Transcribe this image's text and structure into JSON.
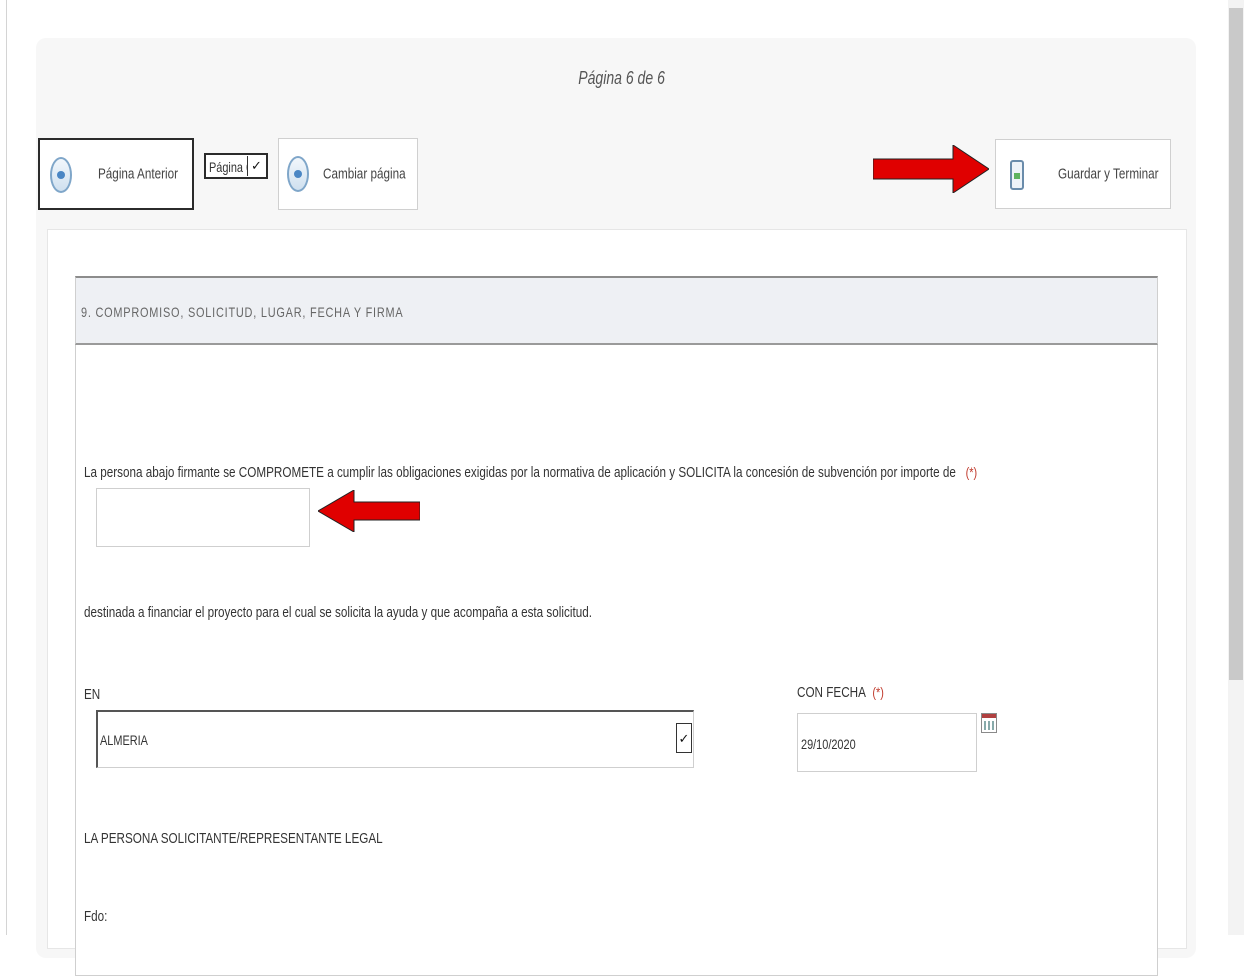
{
  "page_indicator": "Página 6 de 6",
  "toolbar": {
    "prev_label": "Página Anterior",
    "page_select_value": "Página 6",
    "change_label": "Cambiar página",
    "save_label": "Guardar y Terminar"
  },
  "section": {
    "title": "9. COMPROMISO, SOLICITUD, LUGAR, FECHA Y FIRMA",
    "commitment_text": "La persona abajo firmante se COMPROMETE a cumplir las obligaciones exigidas por la normativa de aplicación y SOLICITA la concesión de subvención por importe de",
    "required_mark": "(*)",
    "amount_value": "",
    "destination_text": "destinada a financiar el proyecto para el cual se solicita la ayuda y que acompaña a esta solicitud.",
    "place_label": "EN",
    "place_value": "ALMERIA",
    "date_label": "CON FECHA",
    "date_required_mark": "(*)",
    "date_value": "29/10/2020",
    "signer_label": "LA PERSONA SOLICITANTE/REPRESENTANTE LEGAL",
    "signature_label": "Fdo:"
  },
  "colors": {
    "arrow": "#e00000",
    "required": "#c0392b",
    "header_bg": "#eef0f4"
  },
  "icons": {
    "prev": "prev-page-icon",
    "change": "change-page-icon",
    "save": "save-finish-icon",
    "calendar": "calendar-icon",
    "dropdown": "chevron-down-icon"
  }
}
